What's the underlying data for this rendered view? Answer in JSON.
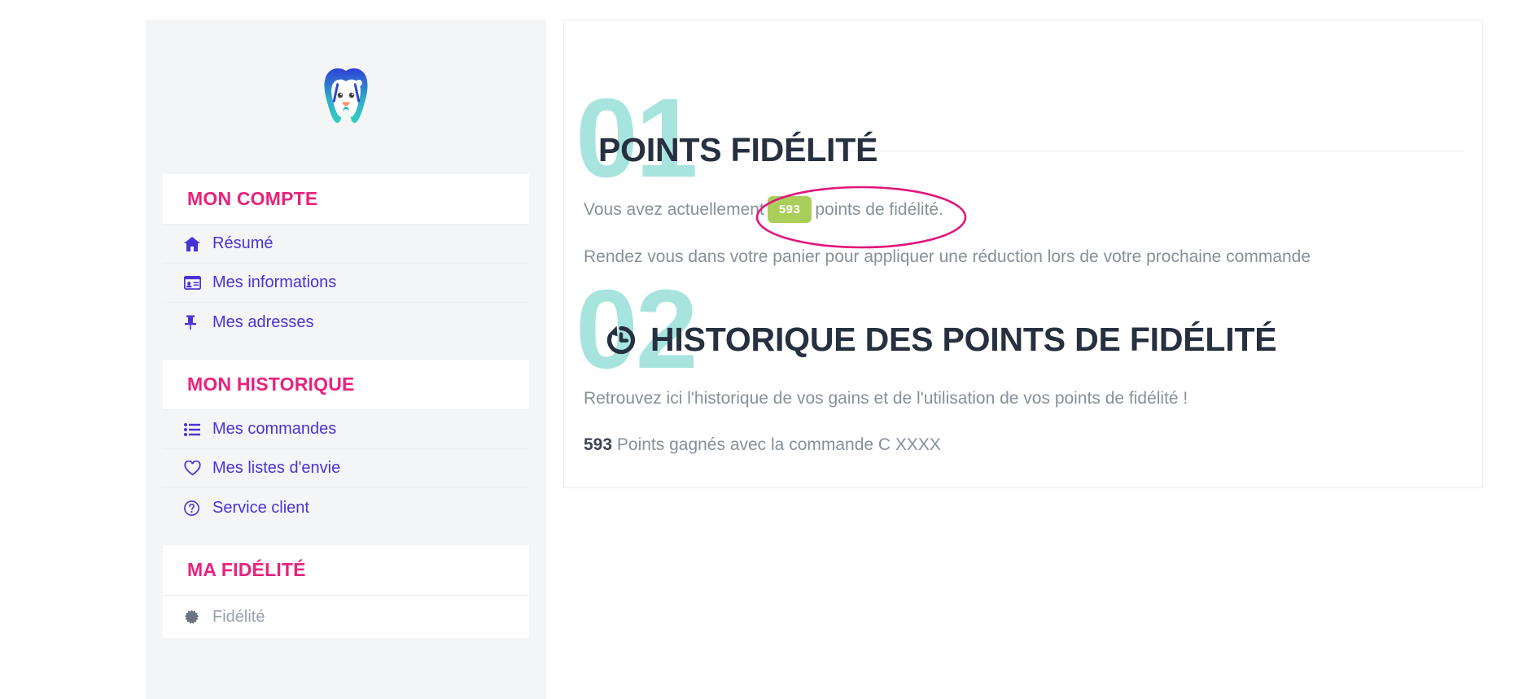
{
  "sidebar": {
    "logo": {
      "icon": "tooth-mascot-logo",
      "alt": "Logo dent"
    },
    "sections": [
      {
        "title": "MON COMPTE",
        "items": [
          {
            "label": "Résumé",
            "icon": "home-icon"
          },
          {
            "label": "Mes informations",
            "icon": "id-card-icon"
          },
          {
            "label": "Mes adresses",
            "icon": "pin-icon"
          }
        ]
      },
      {
        "title": "MON HISTORIQUE",
        "items": [
          {
            "label": "Mes commandes",
            "icon": "list-icon"
          },
          {
            "label": "Mes listes d'envie",
            "icon": "heart-icon"
          },
          {
            "label": "Service client",
            "icon": "question-circle-icon"
          }
        ]
      },
      {
        "title": "MA FIDÉLITÉ",
        "items": [
          {
            "label": "Fidélité",
            "icon": "sunburst-icon",
            "active": true
          }
        ]
      }
    ]
  },
  "main": {
    "section1": {
      "number": "01",
      "title": "POINTS FIDÉLITÉ",
      "line1_before": "Vous avez actuellement",
      "points_badge": "593",
      "line1_after": "points de fidélité.",
      "line2": "Rendez vous dans votre panier pour appliquer une réduction lors de votre prochaine commande"
    },
    "section2": {
      "number": "02",
      "icon": "history-icon",
      "title": "HISTORIQUE DES POINTS DE FIDÉLITÉ",
      "intro": "Retrouvez ici l'historique de vos gains et de l'utilisation de vos points de fidélité !",
      "entry_points": "593",
      "entry_text": "Points gagnés avec la commande C XXXX"
    }
  },
  "annotation": {
    "shape": "ellipse-highlight",
    "color": "#e2157b"
  },
  "colors": {
    "accent_pink": "#e7237d",
    "link_purple": "#4834d4",
    "heading_navy": "#26303f",
    "number_mint": "#a8e4de",
    "badge_green": "#aace5a",
    "body_gray": "#879099",
    "panel_gray": "#f4f5f7"
  }
}
